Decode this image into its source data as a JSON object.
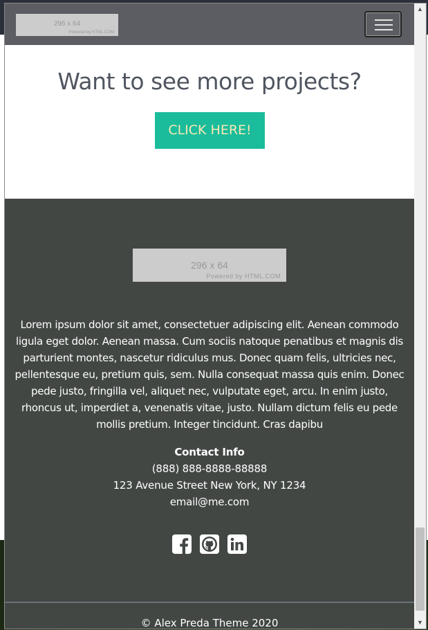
{
  "navbar": {
    "logo": {
      "dimensions": "296 x 64",
      "powered": "Powered by HTML.COM"
    },
    "toggler_icon": "hamburger-icon"
  },
  "projects": {
    "heading": "Want to see more projects?",
    "cta_label": "CLICK HERE!"
  },
  "footer": {
    "logo": {
      "dimensions": "296 x 64",
      "powered": "Powered by HTML.COM"
    },
    "about": "Lorem ipsum dolor sit amet, consectetuer adipiscing elit. Aenean commodo ligula eget dolor. Aenean massa. Cum sociis natoque penatibus et magnis dis parturient montes, nascetur ridiculus mus. Donec quam felis, ultricies nec, pellentesque eu, pretium quis, sem. Nulla consequat massa quis enim. Donec pede justo, fringilla vel, aliquet nec, vulputate eget, arcu. In enim justo, rhoncus ut, imperdiet a, venenatis vitae, justo. Nullam dictum felis eu pede mollis pretium. Integer tincidunt. Cras dapibu",
    "contact": {
      "heading": "Contact Info",
      "phone": "(888) 888-8888-88888",
      "address": "123 Avenue Street New York, NY 1234",
      "email": "email@me.com"
    },
    "socials": [
      "facebook-icon",
      "github-icon",
      "linkedin-icon"
    ],
    "copyright": "© Alex Preda Theme 2020"
  },
  "colors": {
    "navbar": "#5b5d62",
    "accent": "#1bbc9b",
    "cta_text": "#f6e8b4",
    "footer": "#424744",
    "heading": "#4f5560"
  }
}
